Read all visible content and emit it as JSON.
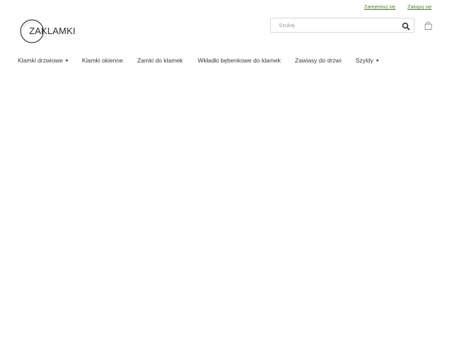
{
  "header": {
    "account": {
      "register_label": "Zarejestruj się",
      "login_label": "Zaloguj się"
    },
    "logo": {
      "text": "ZAKLAMKI"
    },
    "search": {
      "placeholder": "Szukaj",
      "value": ""
    },
    "cart": {
      "icon": "shopping-bag-icon"
    }
  },
  "nav": {
    "items": [
      {
        "label": "Klamki drzwiowe",
        "has_dropdown": true
      },
      {
        "label": "Klamki okienne",
        "has_dropdown": false
      },
      {
        "label": "Zamki do klamek",
        "has_dropdown": false
      },
      {
        "label": "Wkładki bębenkowe do klamek",
        "has_dropdown": false
      },
      {
        "label": "Zawiasy do drzwi",
        "has_dropdown": false
      },
      {
        "label": "Szyldy",
        "has_dropdown": true
      }
    ]
  },
  "colors": {
    "account_link": "#5a7a3a",
    "text": "#3a3a3a",
    "border": "#d9d9d9"
  }
}
